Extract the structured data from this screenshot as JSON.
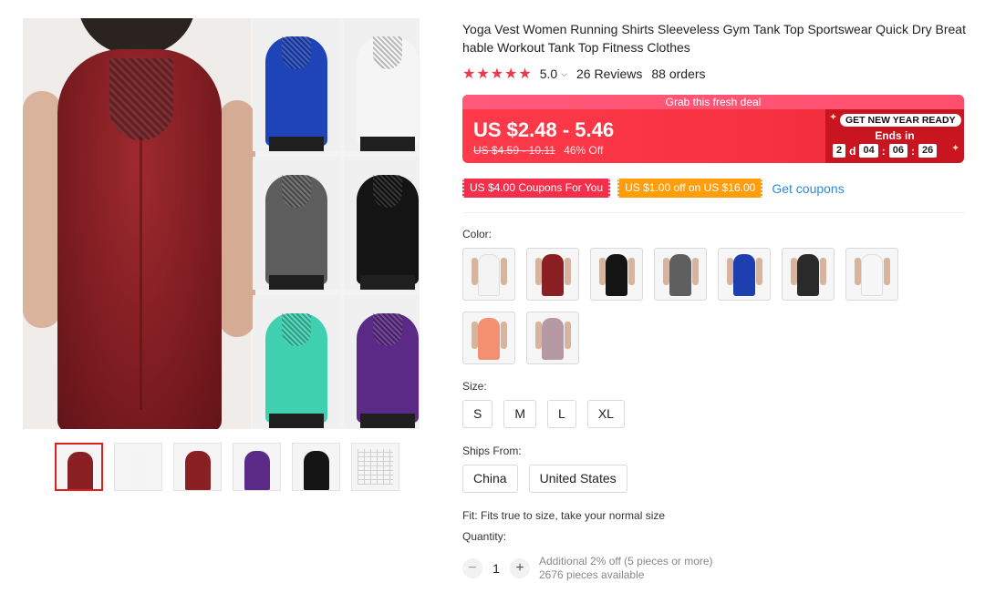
{
  "product": {
    "title": "Yoga Vest Women Running Shirts Sleeveless Gym Tank Top Sportswear Quick Dry Breathable Workout Tank Top Fitness Clothes",
    "rating": "5.0",
    "reviews": "26 Reviews",
    "orders": "88 orders"
  },
  "deal": {
    "banner": "Grab this fresh deal",
    "price": "US $2.48 - 5.46",
    "old_price": "US $4.59 - 10.11",
    "discount": "46% Off",
    "promo": "GET NEW YEAR READY",
    "ends_in": "Ends in",
    "countdown": {
      "days": "2",
      "days_unit": "d",
      "hours": "04",
      "minutes": "06",
      "seconds": "26"
    }
  },
  "coupons": {
    "items": [
      "US $4.00 Coupons For You",
      "US $1.00 off on US $16.00"
    ],
    "link": "Get coupons"
  },
  "color": {
    "label": "Color:",
    "swatch_colors": [
      "#f4f4f4",
      "#8a1f24",
      "#141414",
      "#5f5f5f",
      "#1d3fb0",
      "#2a2a2a",
      "#f7f7f7",
      "#f2906f",
      "#b59aa6"
    ]
  },
  "size": {
    "label": "Size:",
    "options": [
      "S",
      "M",
      "L",
      "XL"
    ]
  },
  "ships": {
    "label": "Ships From:",
    "options": [
      "China",
      "United States"
    ]
  },
  "fit": "Fit: Fits true to size, take your normal size",
  "quantity": {
    "label": "Quantity:",
    "minus": "−",
    "value": "1",
    "plus": "+",
    "note1": "Additional 2% off (5 pieces or more)",
    "note2": "2676 pieces available"
  },
  "gallery": {
    "tile_colors": [
      "#1f44b8",
      "#f5f5f5",
      "#5d5d5d",
      "#141414",
      "#3fd0b0",
      "#5b2a86"
    ],
    "thumb_colors": [
      "#8a1f24",
      "#f4f4f4",
      "#8a1f24",
      "#5b2a86",
      "#141414",
      "chart"
    ]
  },
  "colors": {
    "accent": "#f0374a",
    "link": "#2e8ad6",
    "coupon_orange": "#ff9d0a"
  }
}
